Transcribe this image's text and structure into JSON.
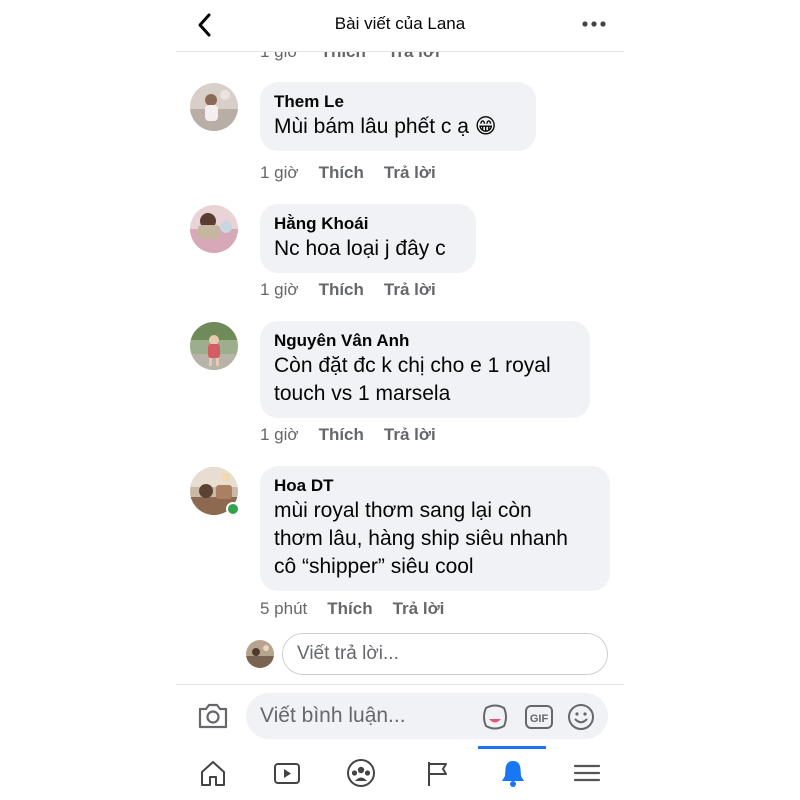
{
  "header": {
    "title": "Bài viết của Lana",
    "back_icon": "chevron-left-icon",
    "more_icon": "more-horizontal-icon"
  },
  "previous_actions": {
    "time": "1 giờ",
    "like": "Thích",
    "reply": "Trả lời"
  },
  "comments": [
    {
      "author": "Them Le",
      "lines": [
        "Mùi bám lâu phết c ạ 😁"
      ],
      "time": "1 giờ",
      "like": "Thích",
      "reply": "Trả lời"
    },
    {
      "author": "Hằng Khoái",
      "lines": [
        "Nc hoa loại j đây c"
      ],
      "time": "1 giờ",
      "like": "Thích",
      "reply": "Trả lời"
    },
    {
      "author": "Nguyên Vân Anh",
      "lines": [
        "Còn đặt đc k chị cho e 1 royal",
        "touch vs 1 marsela"
      ],
      "time": "1 giờ",
      "like": "Thích",
      "reply": "Trả lời"
    },
    {
      "author": "Hoa DT",
      "lines": [
        "mùi royal thơm sang lại còn",
        "thơm lâu, hàng ship siêu nhanh",
        "cô “shipper” siêu cool"
      ],
      "time": "5 phút",
      "like": "Thích",
      "reply": "Trả lời",
      "online": true
    }
  ],
  "reply_box": {
    "placeholder": "Viết trả lời..."
  },
  "composer": {
    "placeholder": "Viết bình luận...",
    "camera_icon": "camera-icon",
    "avatar_icon": "avatar-sticker-icon",
    "gif_label": "GIF",
    "emoji_icon": "emoji-icon"
  },
  "bottom_nav": {
    "items": [
      "home-icon",
      "video-icon",
      "groups-icon",
      "pages-flag-icon",
      "notifications-bell-icon",
      "menu-icon"
    ],
    "active": "notifications-bell-icon"
  },
  "colors": {
    "accent": "#1877f2",
    "bubble": "#f0f2f5",
    "secondary_text": "#65676b",
    "online": "#31a24c"
  }
}
